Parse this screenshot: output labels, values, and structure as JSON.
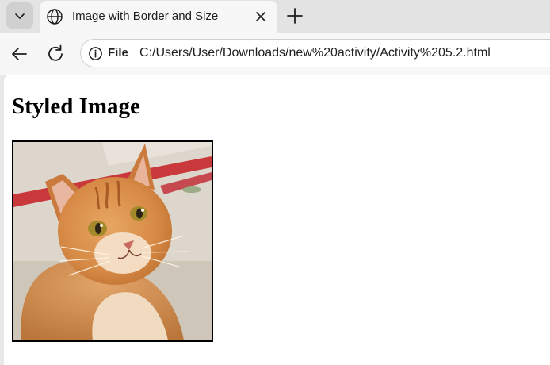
{
  "browser": {
    "tab": {
      "title": "Image with Border and Size",
      "favicon": "globe-icon"
    },
    "toolbar": {
      "scheme_label": "File",
      "url": "C:/Users/User/Downloads/new%20activity/Activity%205.2.html"
    },
    "icons": [
      "tab-list-chevron-icon",
      "globe-icon",
      "close-icon",
      "plus-icon",
      "back-arrow-icon",
      "reload-icon",
      "info-icon"
    ]
  },
  "page": {
    "heading": "Styled Image",
    "image": {
      "subject": "orange tabby cat",
      "border_color": "#000000"
    }
  },
  "colors": {
    "tab_strip": "#e3e3e3",
    "toolbar": "#f7f7f7",
    "page_bg": "#ffffff",
    "text": "#1f1f1f"
  }
}
